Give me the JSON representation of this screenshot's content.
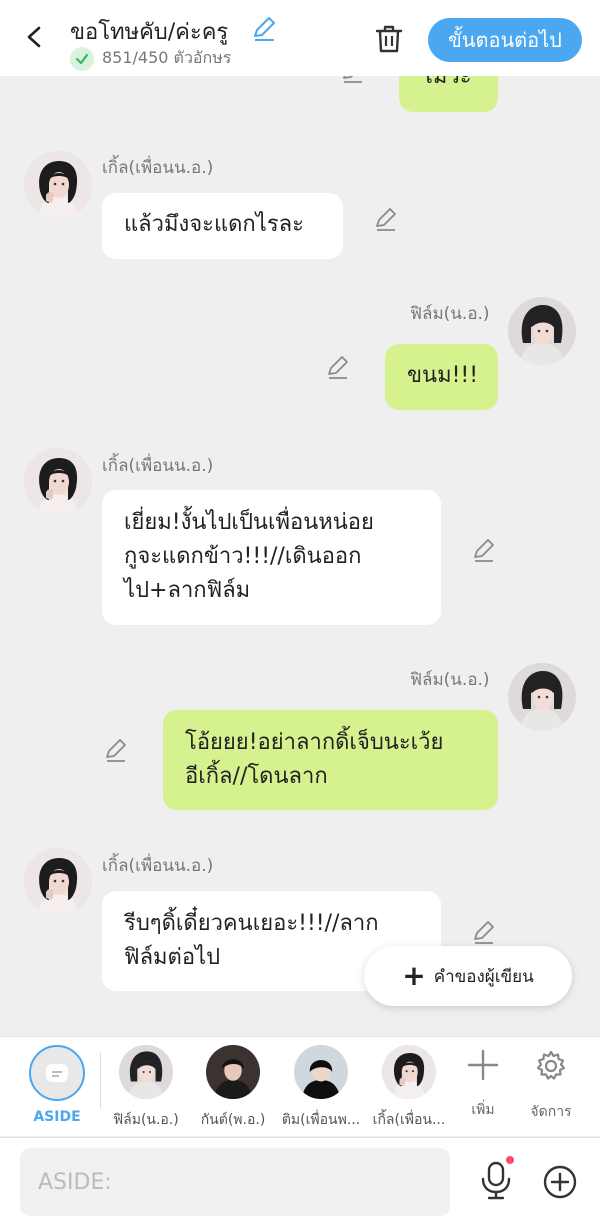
{
  "header": {
    "title": "ขอโทษคับ/ค่ะครู",
    "char_count": "851/450 ตัวอักษร",
    "next_label": "ขั้นตอนต่อไป"
  },
  "messages": [
    {
      "side": "right",
      "sender": "",
      "text": "เมวะ"
    },
    {
      "side": "left",
      "sender": "เกิ้ล(เพื่อนน.อ.)",
      "text": "แล้วมึงจะแดกไรละ"
    },
    {
      "side": "right",
      "sender": "ฟิล์ม(น.อ.)",
      "text": "ขนม!!!"
    },
    {
      "side": "left",
      "sender": "เกิ้ล(เพื่อนน.อ.)",
      "text": "เยี่ยม!งั้นไปเป็นเพื่อนหน่อย\nกูจะแดกข้าว!!!//เดินออก\nไป+ลากฟิล์ม"
    },
    {
      "side": "right",
      "sender": "ฟิล์ม(น.อ.)",
      "text": "โอ้ยยย!อย่าลากดิ้เจ็บนะเว้ย\nอีเกิ้ล//โดนลาก"
    },
    {
      "side": "left",
      "sender": "เกิ้ล(เพื่อนน.อ.)",
      "text": "รีบๆดิ้เดี๋ยวคนเยอะ!!!//ลาก\nฟิล์มต่อไป"
    }
  ],
  "writer_button": "คำของผู้เขียน",
  "characters": {
    "aside": "ASIDE",
    "items": [
      "ฟิล์ม(น.อ.)",
      "กันต์(พ.อ.)",
      "ติม(เพื่อนพ...",
      "เกิ้ล(เพื่อน..."
    ],
    "add_label": "เพิ่ม",
    "manage_label": "จัดการ"
  },
  "input": {
    "placeholder": "ASIDE:"
  },
  "colors": {
    "accent": "#4aa7f0",
    "bubble_green": "#d5f28e",
    "bubble_white": "#ffffff",
    "background": "#efefef"
  },
  "icons": [
    "chevron-left-icon",
    "pencil-icon",
    "check-icon",
    "trash-icon",
    "plus-icon",
    "gear-icon",
    "microphone-icon",
    "add-circle-icon",
    "aside-chat-icon"
  ]
}
